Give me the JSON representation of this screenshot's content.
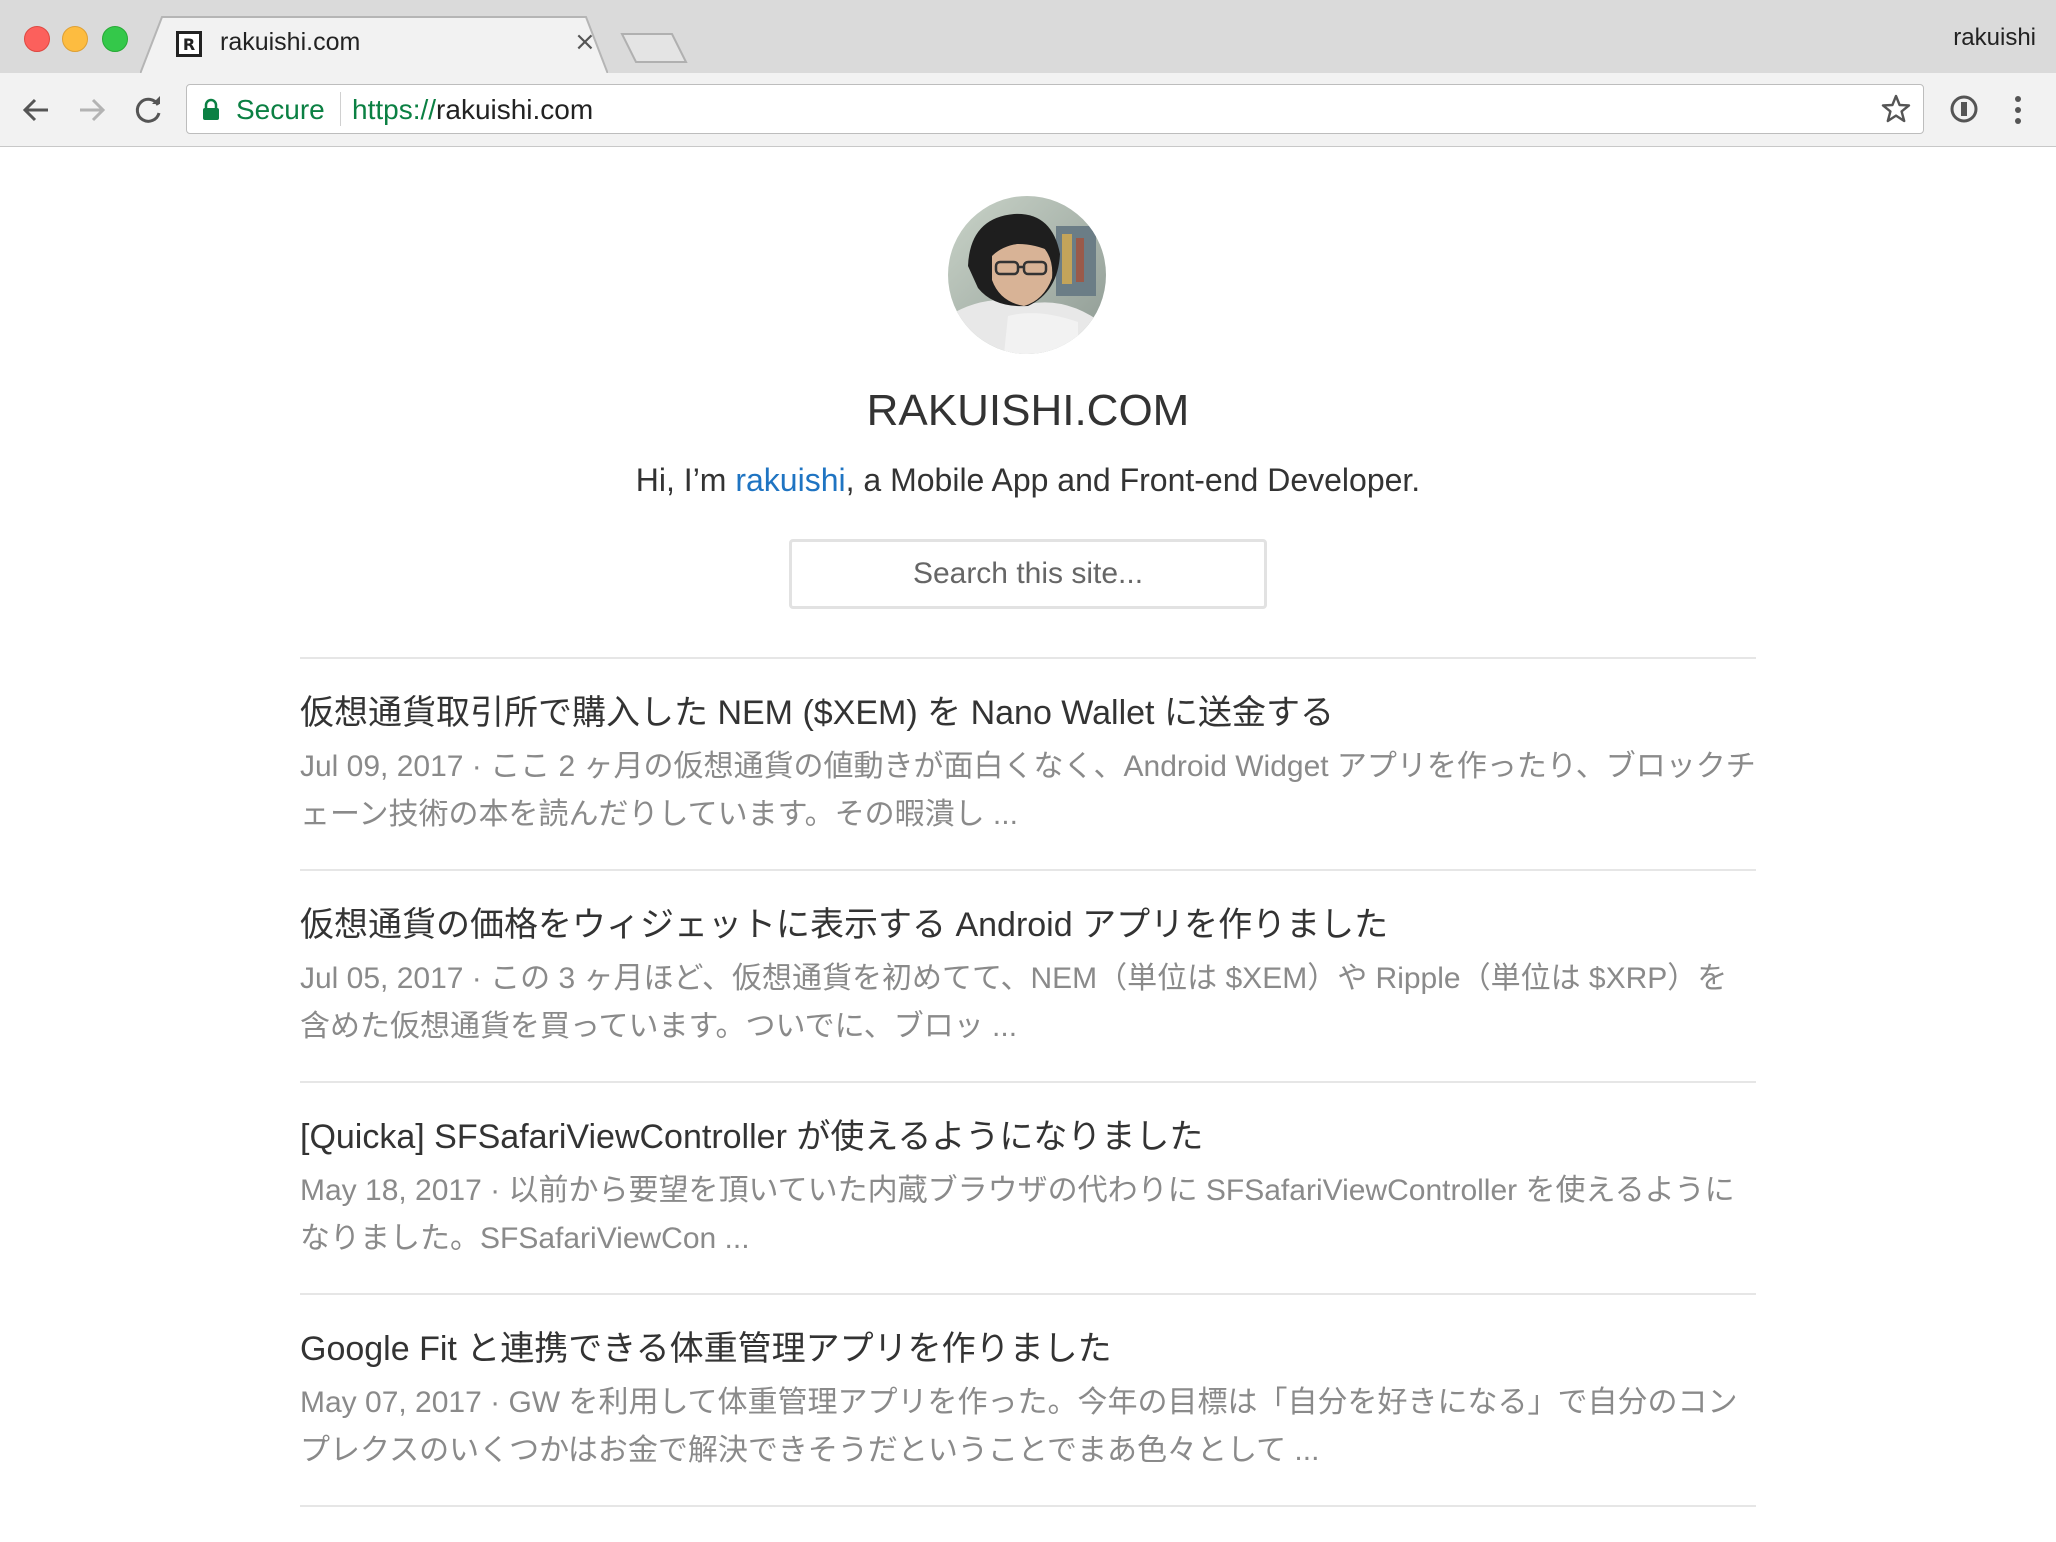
{
  "browser": {
    "tab_title": "rakuishi.com",
    "tab_close": "×",
    "favicon_letter": "R",
    "profile_name": "rakuishi",
    "secure_label": "Secure",
    "url_scheme": "https://",
    "url_host": "rakuishi.com",
    "icons": [
      "back-icon",
      "forward-icon",
      "reload-icon",
      "lock-icon",
      "star-icon",
      "extension-icon",
      "menu-icon"
    ]
  },
  "header": {
    "site_title": "RAKUISHI.COM",
    "tagline_pre": "Hi, I’m ",
    "tagline_link": "rakuishi",
    "tagline_post": ", a Mobile App and Front-end Developer.",
    "search_placeholder": "Search this site..."
  },
  "posts": [
    {
      "title": "仮想通貨取引所で購入した NEM ($XEM) を Nano Wallet に送金する",
      "date": "Jul 09, 2017",
      "separator": " · ",
      "excerpt": "ここ 2 ヶ月の仮想通貨の値動きが面白くなく、Android Widget アプリを作ったり、ブロックチェーン技術の本を読んだりしています。その暇潰し ..."
    },
    {
      "title": "仮想通貨の価格をウィジェットに表示する Android アプリを作りました",
      "date": "Jul 05, 2017",
      "separator": " · ",
      "excerpt": "この 3 ヶ月ほど、仮想通貨を初めてて、NEM（単位は $XEM）や Ripple（単位は $XRP）を含めた仮想通貨を買っています。ついでに、ブロッ ..."
    },
    {
      "title": "[Quicka] SFSafariViewController が使えるようになりました",
      "date": "May 18, 2017",
      "separator": " · ",
      "excerpt": "以前から要望を頂いていた内蔵ブラウザの代わりに SFSafariViewController を使えるようになりました。SFSafariViewCon ..."
    },
    {
      "title": "Google Fit と連携できる体重管理アプリを作りました",
      "date": "May 07, 2017",
      "separator": " · ",
      "excerpt": "GW を利用して体重管理アプリを作った。今年の目標は「自分を好きになる」で自分のコンプレクスのいくつかはお金で解決できそうだということでまあ色々として ..."
    }
  ]
}
